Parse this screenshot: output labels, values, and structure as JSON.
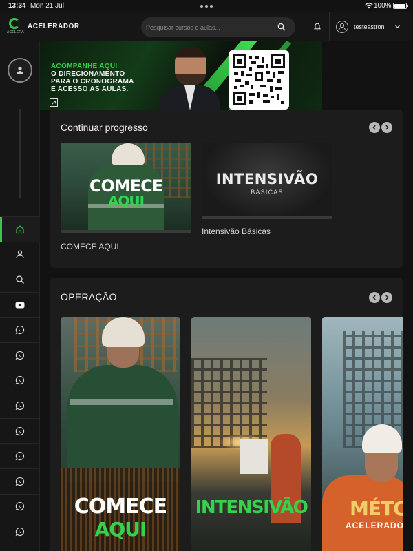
{
  "statusbar": {
    "time": "13:34",
    "date": "Mon 21 Jul",
    "battery": "100%"
  },
  "header": {
    "logo_text": "ACELERA",
    "brand": "ACELERADOR",
    "search_placeholder": "Pesquisar cursos e aulas...",
    "username": "testeastron"
  },
  "banner": {
    "line1": "ACOMPANHE AQUI",
    "line2": "O DIRECIONAMENTO",
    "line3": "PARA O CRONOGRAMA",
    "line4": "E ACESSO AS AULAS."
  },
  "sidebar": {
    "items": [
      {
        "icon": "home-icon",
        "active": true
      },
      {
        "icon": "user-icon"
      },
      {
        "icon": "search-icon"
      },
      {
        "icon": "youtube-icon"
      },
      {
        "icon": "whatsapp-icon"
      },
      {
        "icon": "whatsapp-icon"
      },
      {
        "icon": "whatsapp-icon"
      },
      {
        "icon": "whatsapp-icon"
      },
      {
        "icon": "whatsapp-icon"
      },
      {
        "icon": "whatsapp-icon"
      },
      {
        "icon": "whatsapp-icon"
      },
      {
        "icon": "whatsapp-icon"
      },
      {
        "icon": "whatsapp-icon"
      }
    ]
  },
  "progress": {
    "title": "Continuar progresso",
    "cards": [
      {
        "thumb_line1": "COMECE",
        "thumb_line2": "AQUI",
        "label": "COMECE AQUI"
      },
      {
        "thumb_line1": "INTENSIVÃO",
        "thumb_line2": "BÁSICAS",
        "label": "Intensivão Básicas"
      }
    ]
  },
  "operacao": {
    "title": "OPERAÇÃO",
    "tiles": [
      {
        "line1": "COMECE",
        "line2": "AQUI"
      },
      {
        "line1": "INTENSIVÃO"
      },
      {
        "line1": "MÉTODO",
        "line2": "ACELERADOR"
      }
    ]
  },
  "colors": {
    "accent": "#3ec34c",
    "background": "#121212",
    "panel": "#1c1c1c"
  }
}
